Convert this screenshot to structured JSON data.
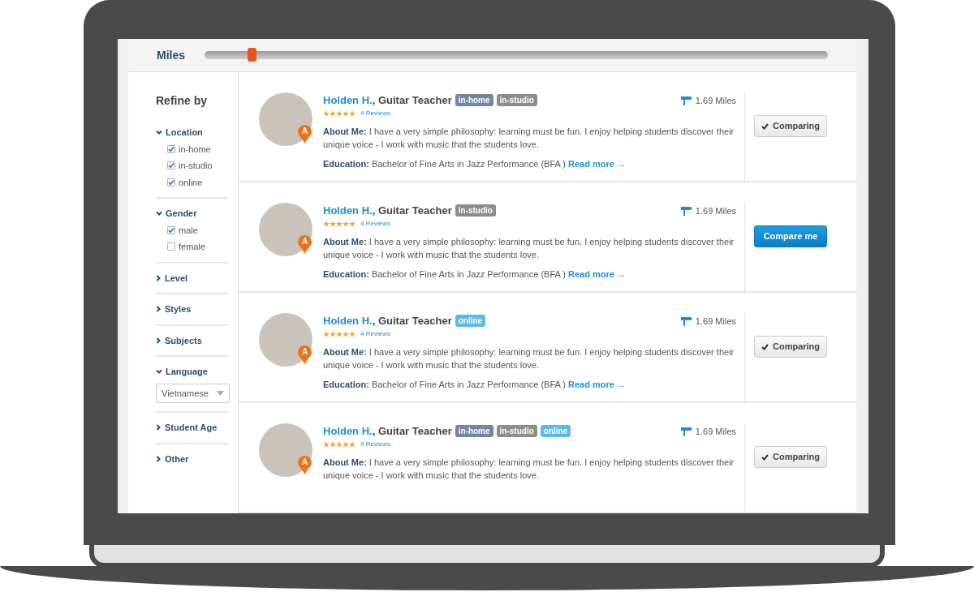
{
  "filter_bar": {
    "label": "Miles",
    "slider": {
      "level": 0.075
    }
  },
  "sidebar": {
    "title": "Refine by",
    "sections": [
      {
        "kind": "checkboxes",
        "label": "Location",
        "expanded": true,
        "options": [
          {
            "label": "in-home",
            "checked": true
          },
          {
            "label": "in-studio",
            "checked": true
          },
          {
            "label": "online",
            "checked": true
          }
        ]
      },
      {
        "kind": "checkboxes",
        "label": "Gender",
        "expanded": true,
        "options": [
          {
            "label": "male",
            "checked": true
          },
          {
            "label": "female",
            "checked": false
          }
        ]
      },
      {
        "label": "Level",
        "expanded": false
      },
      {
        "label": "Styles",
        "expanded": false
      },
      {
        "label": "Subjects",
        "expanded": false
      },
      {
        "kind": "select",
        "label": "Language",
        "expanded": true,
        "value": "Vietnamese"
      },
      {
        "label": "Student Age",
        "expanded": false
      },
      {
        "label": "Other",
        "expanded": false
      }
    ]
  },
  "teachers": [
    {
      "name": "Holden H.",
      "role": ", Guitar Teacher",
      "pin_label": "A",
      "tags": [
        {
          "label": "in-home",
          "color": "#6f88a1"
        },
        {
          "label": "in-studio",
          "color": "#8c8c8c"
        }
      ],
      "stars": 5,
      "reviews": "4 Reviews",
      "about_label": "About Me:",
      "about": "I have a very simple philosophy: learning must be fun.  I enjoy helping students discover their unique voice - I work with music that the students love.",
      "education_label": "Education:",
      "education": "Bachelor of Fine Arts in Jazz Performance (BFA )",
      "read_more": "Read more →",
      "distance": "1.69 Miles",
      "comparing": true,
      "button": "Comparing"
    },
    {
      "name": "Holden H.",
      "role": ", Guitar Teacher",
      "pin_label": "A",
      "tags": [
        {
          "label": "in-studio",
          "color": "#8c8c8c"
        }
      ],
      "stars": 5,
      "reviews": "4 Reviews",
      "about_label": "About Me:",
      "about": "I have a very simple philosophy: learning must be fun.  I enjoy helping students discover their unique voice - I work with music that the students love.",
      "education_label": "Education:",
      "education": "Bachelor of Fine Arts in Jazz Performance (BFA )",
      "read_more": "Read more →",
      "distance": "1.69 Miles",
      "comparing": false,
      "button": "Compare me"
    },
    {
      "name": "Holden H.",
      "role": ", Guitar Teacher",
      "pin_label": "A",
      "tags": [
        {
          "label": "online",
          "color": "#5bbbe8"
        }
      ],
      "stars": 5,
      "reviews": "4 Reviews",
      "about_label": "About Me:",
      "about": "I have a very simple philosophy: learning must be fun.  I enjoy helping students discover their unique voice - I work with music that the students love.",
      "education_label": "Education:",
      "education": "Bachelor of Fine Arts in Jazz Performance (BFA )",
      "read_more": "Read more →",
      "distance": "1.69 Miles",
      "comparing": true,
      "button": "Comparing"
    },
    {
      "name": "Holden H.",
      "role": ", Guitar Teacher",
      "pin_label": "A",
      "tags": [
        {
          "label": "in-home",
          "color": "#6f88a1"
        },
        {
          "label": "in-studio",
          "color": "#8c8c8c"
        },
        {
          "label": "online",
          "color": "#5bbbe8"
        }
      ],
      "stars": 5,
      "reviews": "4 Reviews",
      "about_label": "About Me:",
      "about": "I have a very simple philosophy: learning must be fun.  I enjoy helping students discover their unique voice - I work with music that the students love.",
      "distance": "1.69 Miles",
      "comparing": true,
      "button": "Comparing"
    }
  ]
}
